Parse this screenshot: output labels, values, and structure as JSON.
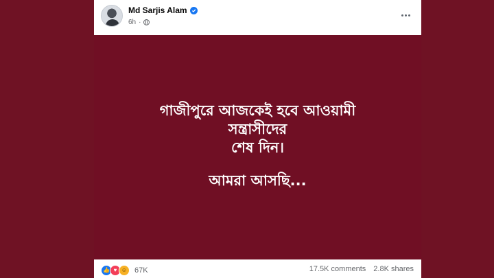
{
  "post": {
    "author": "Md Sarjis Alam",
    "time": "6h",
    "image_text": {
      "line1": "গাজীপুরে আজকেই হবে আওয়ামী",
      "line2": "সন্ত্রাসীদের",
      "line3": "শেষ দিন।",
      "line4": "আমরা আসছি..."
    },
    "reactions_count": "67K",
    "comments": "17.5K comments",
    "shares": "2.8K shares"
  },
  "icons": {
    "verified": "verified-badge-icon",
    "audience": "globe-icon",
    "more": "more-options-icon",
    "reactions": [
      "like-icon",
      "love-icon",
      "haha-icon"
    ]
  },
  "colors": {
    "post_background": "#700f24",
    "accent": "#1877f2"
  }
}
